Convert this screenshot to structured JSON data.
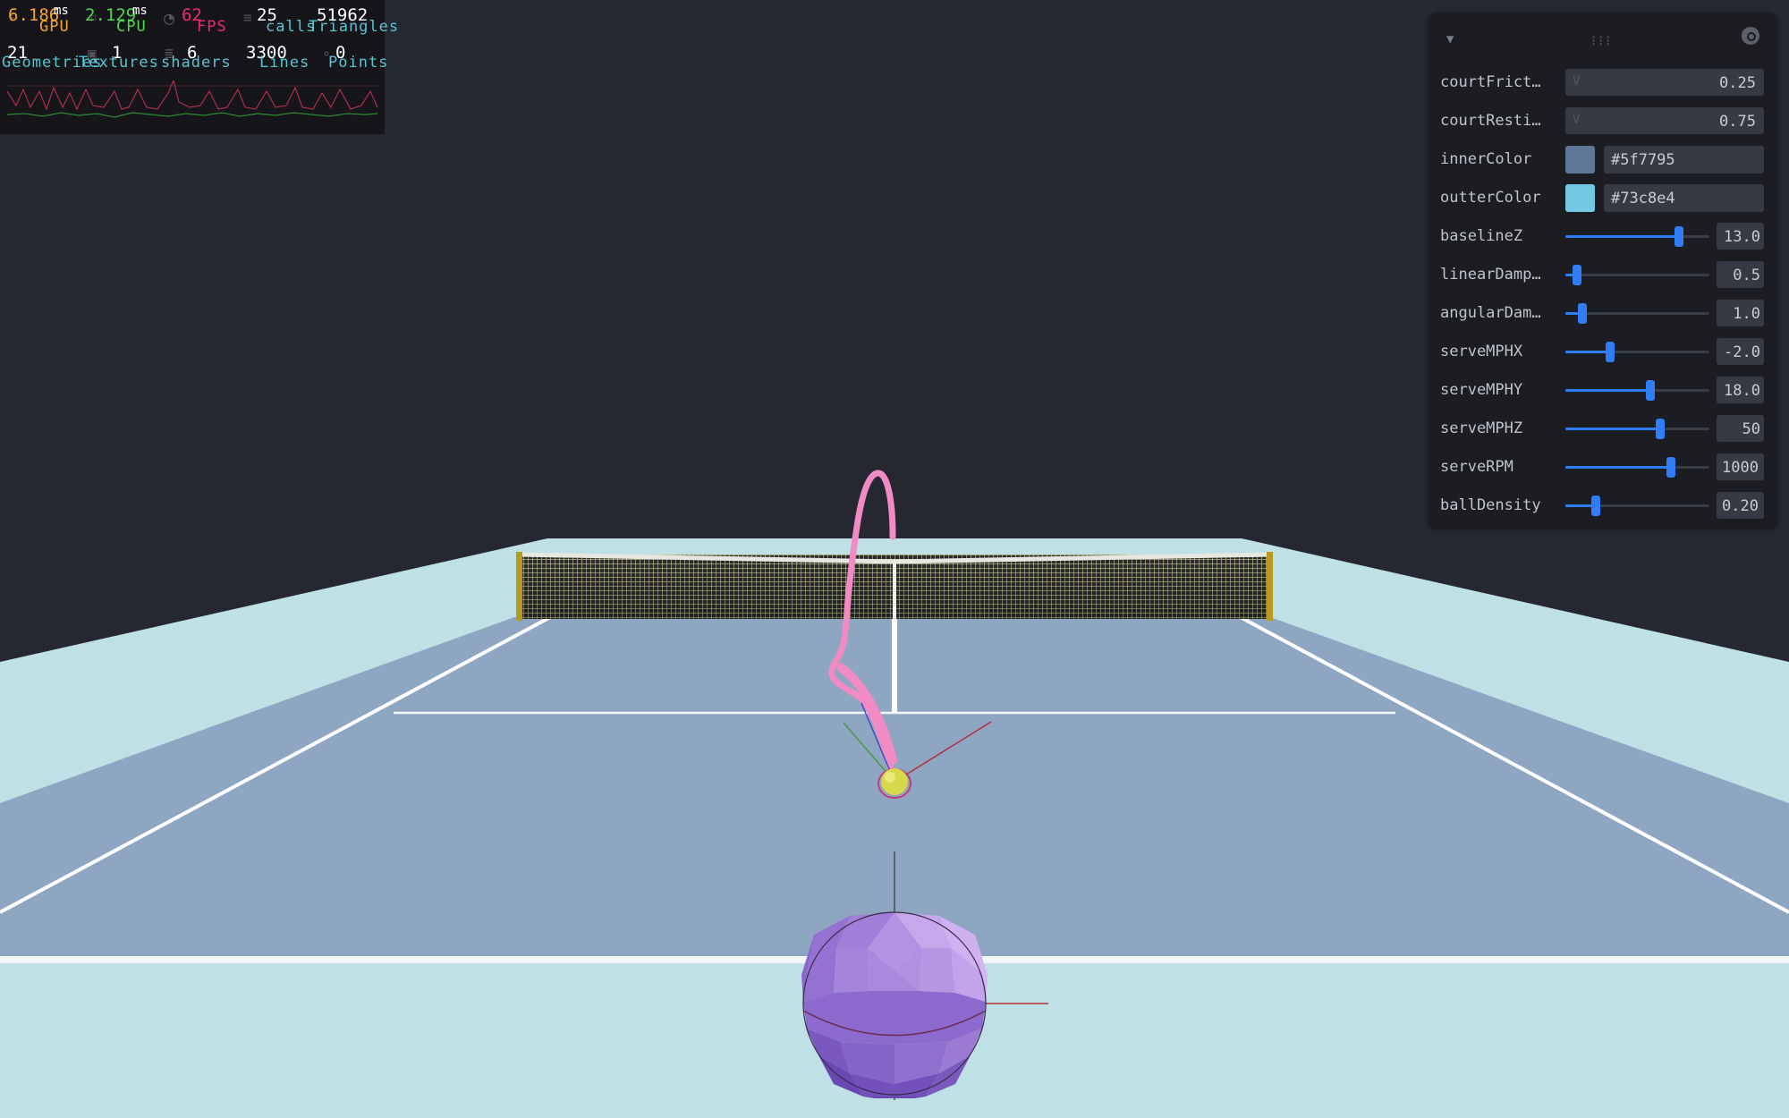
{
  "stats": {
    "gpu": {
      "value": "6.186",
      "unit": "ms",
      "label": "GPU"
    },
    "cpu": {
      "value": "2.129",
      "unit": "ms",
      "label": "CPU"
    },
    "fps": {
      "value": "62",
      "label": "FPS"
    },
    "calls": {
      "value": "25",
      "label": "calls"
    },
    "triangles": {
      "value": "51962",
      "label": "Triangles"
    },
    "geometries": {
      "value": "21",
      "label": "Geometries"
    },
    "textures": {
      "value": "1",
      "label": "Textures"
    },
    "shaders": {
      "value": "6",
      "label": "shaders"
    },
    "lines": {
      "value": "3300",
      "label": "Lines"
    },
    "points": {
      "value": "0",
      "label": "Points"
    },
    "colors": {
      "gpu": "#f7a531",
      "cpu": "#4ed84a",
      "fps": "#ec2c6d",
      "info": "#58c4d4"
    }
  },
  "controls": {
    "court_friction": {
      "label": "courtFrict…",
      "value": "0.25"
    },
    "court_restitution": {
      "label": "courtResti…",
      "value": "0.75"
    },
    "inner_color": {
      "label": "innerColor",
      "value": "#5f7795"
    },
    "outter_color": {
      "label": "outterColor",
      "value": "#73c8e4"
    },
    "baseline_z": {
      "label": "baselineZ",
      "value": "13.0",
      "fraction": 0.79
    },
    "linear_damping": {
      "label": "linearDamp…",
      "value": "0.5",
      "fraction": 0.08
    },
    "angular_damping": {
      "label": "angularDam…",
      "value": "1.0",
      "fraction": 0.12
    },
    "serve_mph_x": {
      "label": "serveMPHX",
      "value": "-2.0",
      "fraction": 0.31
    },
    "serve_mph_y": {
      "label": "serveMPHY",
      "value": "18.0",
      "fraction": 0.59
    },
    "serve_mph_z": {
      "label": "serveMPHZ",
      "value": "50",
      "fraction": 0.66
    },
    "serve_rpm": {
      "label": "serveRPM",
      "value": "1000",
      "fraction": 0.73
    },
    "ball_density": {
      "label": "ballDensity",
      "value": "0.20",
      "fraction": 0.21
    }
  },
  "icons": [
    "collapse-chevron-icon",
    "drag-grip-icon",
    "search-icon"
  ],
  "scene_colors": {
    "background": "#252731",
    "court_inner": "#8ea6c1",
    "court_outer": "#bfe1e6",
    "trajectory": "#f28ac4",
    "ball": "#d6d84a",
    "player_sphere": "#a07cd8"
  }
}
